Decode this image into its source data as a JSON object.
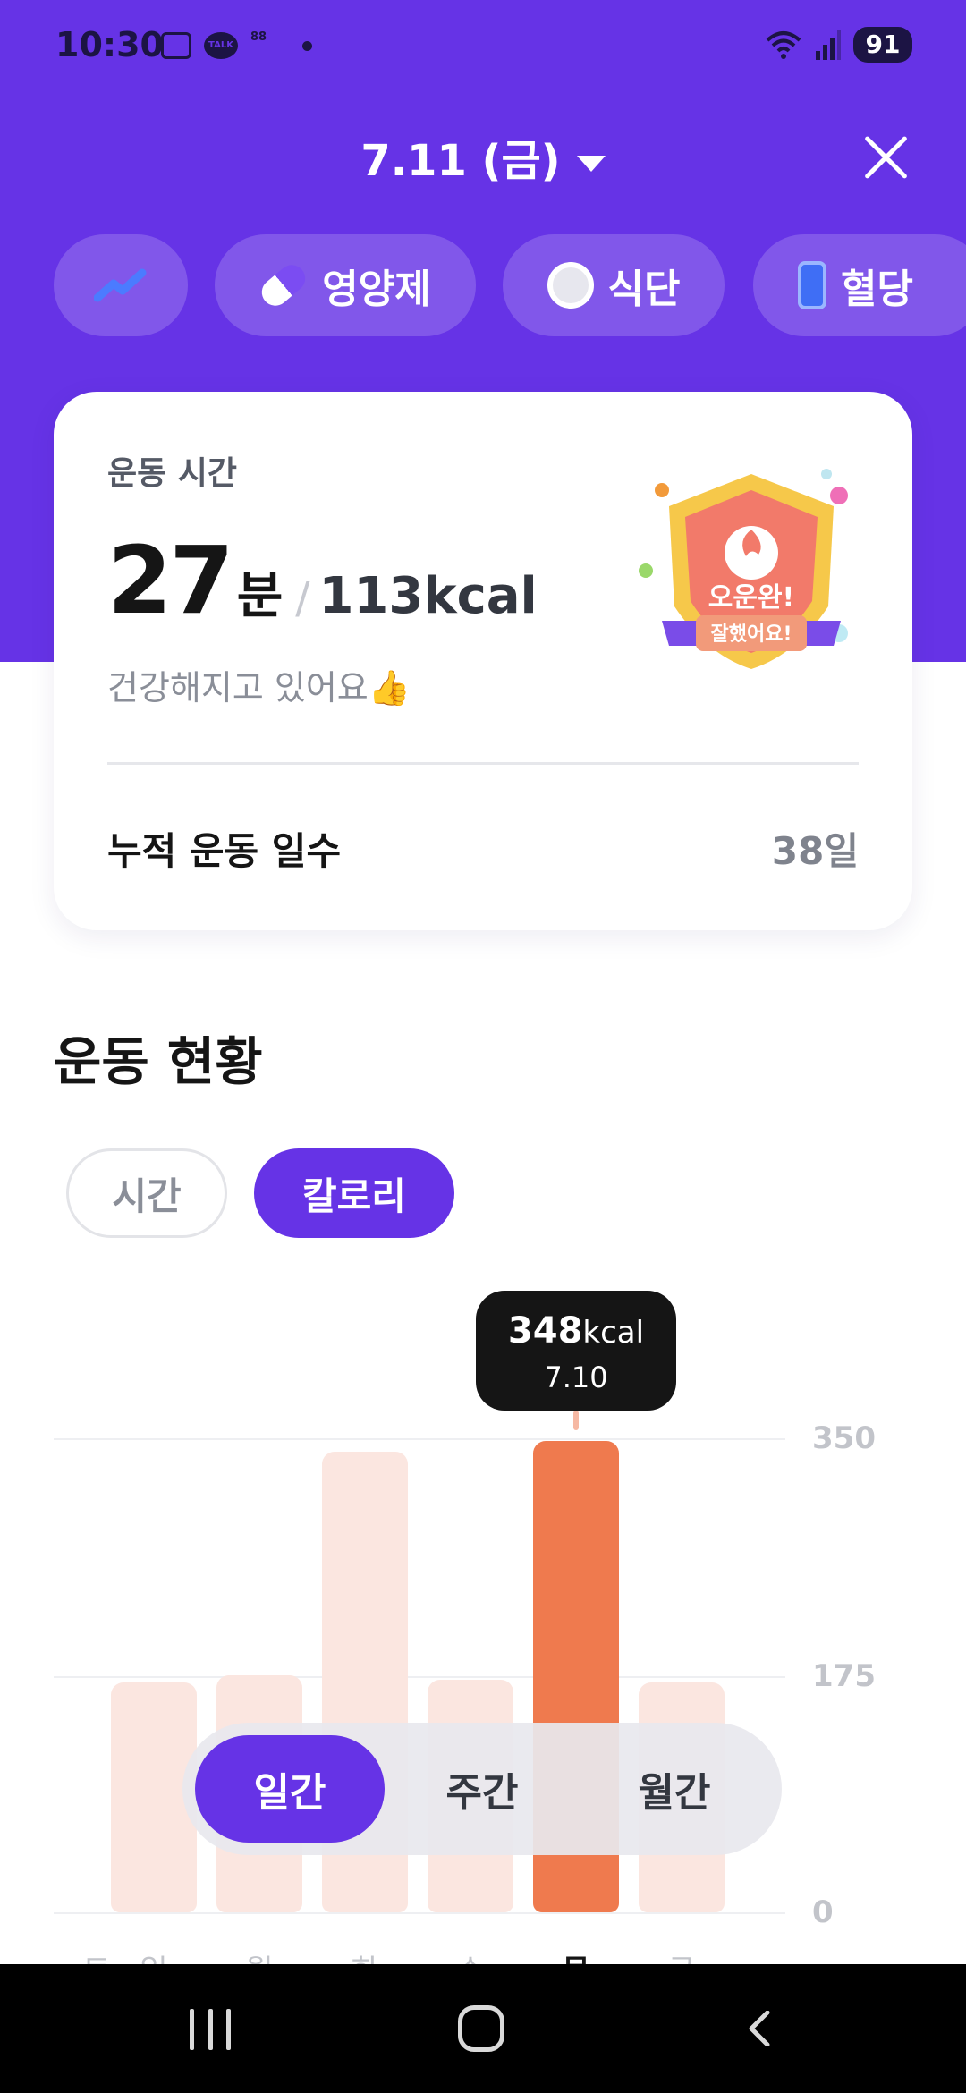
{
  "status_bar": {
    "time": "10:30",
    "icons": [
      "screenshot-icon",
      "kakaotalk-icon",
      "app-icon",
      "dot-icon",
      "wifi-icon",
      "signal-icon"
    ],
    "talk_label": "TALK",
    "battery": "91"
  },
  "header": {
    "date": "7.11 (금)"
  },
  "chips": {
    "supplement": "영양제",
    "meal": "식단",
    "blood_sugar": "혈당"
  },
  "summary": {
    "label": "운동 시간",
    "minutes": "27",
    "minutes_unit": "분",
    "separator": "/",
    "kcal": "113kcal",
    "message": "건강해지고 있어요👍",
    "badge_title": "오운완!",
    "badge_sub": "잘했어요!",
    "accumulated_label": "누적 운동 일수",
    "accumulated_value": "38일"
  },
  "section": {
    "title": "운동 현황",
    "toggle_time": "시간",
    "toggle_calorie": "칼로리"
  },
  "tooltip": {
    "value": "348",
    "unit": "kcal",
    "date": "7.10"
  },
  "chart_data": {
    "type": "bar",
    "categories": [
      "토",
      "일",
      "월",
      "화",
      "수",
      "목",
      "금"
    ],
    "values": [
      170,
      175,
      340,
      172,
      348,
      170
    ],
    "bar_categories": [
      "일",
      "월",
      "화",
      "수",
      "목",
      "금"
    ],
    "highlighted": "목",
    "yticks": [
      "350",
      "175",
      "0"
    ],
    "ylim": [
      0,
      350
    ],
    "colors": {
      "bar": "#fbe6e0",
      "active": "#ef7a4e"
    }
  },
  "period": {
    "daily": "일간",
    "weekly": "주간",
    "monthly": "월간",
    "selected": "일간"
  },
  "colors": {
    "brand": "#6633e6",
    "accent": "#ef7a4e"
  }
}
